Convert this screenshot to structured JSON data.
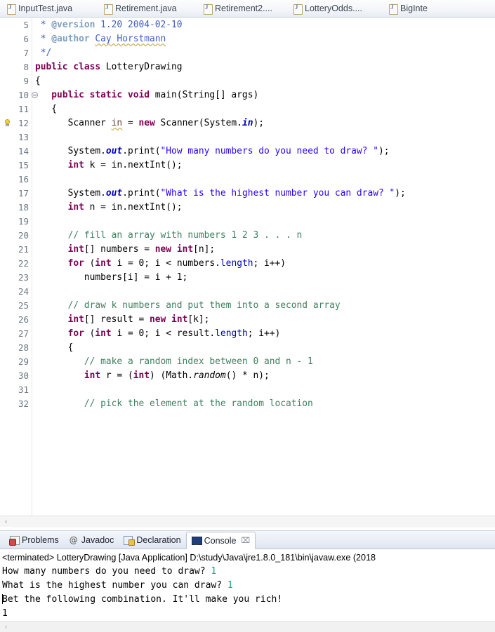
{
  "editor_tabs": [
    {
      "label": "InputTest.java",
      "icon": "java-file-icon",
      "active": false
    },
    {
      "label": "Retirement.java",
      "icon": "java-file-icon",
      "active": false
    },
    {
      "label": "Retirement2....",
      "icon": "java-file-icon",
      "active": false
    },
    {
      "label": "LotteryOdds....",
      "icon": "java-file-icon",
      "active": false
    },
    {
      "label": "BigInte",
      "icon": "java-file-icon",
      "active": false
    }
  ],
  "code": {
    "first_line_number": 5,
    "lines": [
      {
        "n": "5",
        "marker": "",
        "fold": false,
        "tokens": [
          {
            "t": " * ",
            "c": "jdoc"
          },
          {
            "t": "@version",
            "c": "jtag"
          },
          {
            "t": " 1.20 2004-02-10",
            "c": "jdoc"
          }
        ]
      },
      {
        "n": "6",
        "marker": "",
        "fold": false,
        "tokens": [
          {
            "t": " * ",
            "c": "jdoc"
          },
          {
            "t": "@author",
            "c": "jtag"
          },
          {
            "t": " ",
            "c": "jdoc"
          },
          {
            "t": "Cay Horstmann",
            "c": "jdoc ul-sq"
          }
        ]
      },
      {
        "n": "7",
        "marker": "",
        "fold": false,
        "tokens": [
          {
            "t": " */",
            "c": "jdoc"
          }
        ]
      },
      {
        "n": "8",
        "marker": "",
        "fold": false,
        "tokens": [
          {
            "t": "public class",
            "c": "kw"
          },
          {
            "t": " LotteryDrawing",
            "c": "plain"
          }
        ]
      },
      {
        "n": "9",
        "marker": "",
        "fold": false,
        "tokens": [
          {
            "t": "{",
            "c": "plain"
          }
        ]
      },
      {
        "n": "10",
        "marker": "",
        "fold": true,
        "tokens": [
          {
            "t": "   ",
            "c": "plain"
          },
          {
            "t": "public static void",
            "c": "kw"
          },
          {
            "t": " main(String[] args)",
            "c": "plain"
          }
        ]
      },
      {
        "n": "11",
        "marker": "",
        "fold": false,
        "tokens": [
          {
            "t": "   {",
            "c": "plain"
          }
        ]
      },
      {
        "n": "12",
        "marker": "warning",
        "fold": false,
        "tokens": [
          {
            "t": "      Scanner ",
            "c": "plain"
          },
          {
            "t": "in",
            "c": "loc ul-sq"
          },
          {
            "t": " = ",
            "c": "plain"
          },
          {
            "t": "new",
            "c": "kw"
          },
          {
            "t": " Scanner(System.",
            "c": "plain"
          },
          {
            "t": "in",
            "c": "sfld"
          },
          {
            "t": ");",
            "c": "plain"
          }
        ]
      },
      {
        "n": "13",
        "marker": "",
        "fold": false,
        "tokens": [
          {
            "t": "",
            "c": "plain"
          }
        ]
      },
      {
        "n": "14",
        "marker": "",
        "fold": false,
        "tokens": [
          {
            "t": "      System.",
            "c": "plain"
          },
          {
            "t": "out",
            "c": "sfld"
          },
          {
            "t": ".print(",
            "c": "plain"
          },
          {
            "t": "\"How many numbers do you need to draw? \"",
            "c": "str"
          },
          {
            "t": ");",
            "c": "plain"
          }
        ]
      },
      {
        "n": "15",
        "marker": "",
        "fold": false,
        "tokens": [
          {
            "t": "      ",
            "c": "plain"
          },
          {
            "t": "int",
            "c": "kw"
          },
          {
            "t": " k = in.nextInt();",
            "c": "plain"
          }
        ]
      },
      {
        "n": "16",
        "marker": "",
        "fold": false,
        "tokens": [
          {
            "t": "",
            "c": "plain"
          }
        ]
      },
      {
        "n": "17",
        "marker": "",
        "fold": false,
        "tokens": [
          {
            "t": "      System.",
            "c": "plain"
          },
          {
            "t": "out",
            "c": "sfld"
          },
          {
            "t": ".print(",
            "c": "plain"
          },
          {
            "t": "\"What is the highest number you can draw? \"",
            "c": "str"
          },
          {
            "t": ");",
            "c": "plain"
          }
        ]
      },
      {
        "n": "18",
        "marker": "",
        "fold": false,
        "tokens": [
          {
            "t": "      ",
            "c": "plain"
          },
          {
            "t": "int",
            "c": "kw"
          },
          {
            "t": " n = in.nextInt();",
            "c": "plain"
          }
        ]
      },
      {
        "n": "19",
        "marker": "",
        "fold": false,
        "tokens": [
          {
            "t": "",
            "c": "plain"
          }
        ]
      },
      {
        "n": "20",
        "marker": "",
        "fold": false,
        "tokens": [
          {
            "t": "      ",
            "c": "plain"
          },
          {
            "t": "// fill an array with numbers 1 2 3 . . . n",
            "c": "cmt"
          }
        ]
      },
      {
        "n": "21",
        "marker": "",
        "fold": false,
        "tokens": [
          {
            "t": "      ",
            "c": "plain"
          },
          {
            "t": "int",
            "c": "kw"
          },
          {
            "t": "[] numbers = ",
            "c": "plain"
          },
          {
            "t": "new int",
            "c": "kw"
          },
          {
            "t": "[n];",
            "c": "plain"
          }
        ]
      },
      {
        "n": "22",
        "marker": "",
        "fold": false,
        "tokens": [
          {
            "t": "      ",
            "c": "plain"
          },
          {
            "t": "for",
            "c": "kw"
          },
          {
            "t": " (",
            "c": "plain"
          },
          {
            "t": "int",
            "c": "kw"
          },
          {
            "t": " i = 0; i < numbers.",
            "c": "plain"
          },
          {
            "t": "length",
            "c": "fld"
          },
          {
            "t": "; i++)",
            "c": "plain"
          }
        ]
      },
      {
        "n": "23",
        "marker": "",
        "fold": false,
        "tokens": [
          {
            "t": "         numbers[i] = i + 1;",
            "c": "plain"
          }
        ]
      },
      {
        "n": "24",
        "marker": "",
        "fold": false,
        "tokens": [
          {
            "t": "",
            "c": "plain"
          }
        ]
      },
      {
        "n": "25",
        "marker": "",
        "fold": false,
        "tokens": [
          {
            "t": "      ",
            "c": "plain"
          },
          {
            "t": "// draw k numbers and put them into a second array",
            "c": "cmt"
          }
        ]
      },
      {
        "n": "26",
        "marker": "",
        "fold": false,
        "tokens": [
          {
            "t": "      ",
            "c": "plain"
          },
          {
            "t": "int",
            "c": "kw"
          },
          {
            "t": "[] result = ",
            "c": "plain"
          },
          {
            "t": "new int",
            "c": "kw"
          },
          {
            "t": "[k];",
            "c": "plain"
          }
        ]
      },
      {
        "n": "27",
        "marker": "",
        "fold": false,
        "tokens": [
          {
            "t": "      ",
            "c": "plain"
          },
          {
            "t": "for",
            "c": "kw"
          },
          {
            "t": " (",
            "c": "plain"
          },
          {
            "t": "int",
            "c": "kw"
          },
          {
            "t": " i = 0; i < result.",
            "c": "plain"
          },
          {
            "t": "length",
            "c": "fld"
          },
          {
            "t": "; i++)",
            "c": "plain"
          }
        ]
      },
      {
        "n": "28",
        "marker": "",
        "fold": false,
        "tokens": [
          {
            "t": "      {",
            "c": "plain"
          }
        ]
      },
      {
        "n": "29",
        "marker": "",
        "fold": false,
        "tokens": [
          {
            "t": "         ",
            "c": "plain"
          },
          {
            "t": "// make a random index between 0 and n - 1",
            "c": "cmt"
          }
        ]
      },
      {
        "n": "30",
        "marker": "",
        "fold": false,
        "tokens": [
          {
            "t": "         ",
            "c": "plain"
          },
          {
            "t": "int",
            "c": "kw"
          },
          {
            "t": " r = (",
            "c": "plain"
          },
          {
            "t": "int",
            "c": "kw"
          },
          {
            "t": ") (Math.",
            "c": "plain"
          },
          {
            "t": "random",
            "c": "smeth"
          },
          {
            "t": "() * n);",
            "c": "plain"
          }
        ]
      },
      {
        "n": "31",
        "marker": "",
        "fold": false,
        "tokens": [
          {
            "t": "",
            "c": "plain"
          }
        ]
      },
      {
        "n": "32",
        "marker": "",
        "fold": false,
        "tokens": [
          {
            "t": "         ",
            "c": "plain"
          },
          {
            "t": "// pick the element at the random location",
            "c": "cmt"
          }
        ]
      }
    ]
  },
  "view_tabs": [
    {
      "label": "Problems",
      "icon": "problems-icon",
      "active": false,
      "closable": false
    },
    {
      "label": "Javadoc",
      "icon": "javadoc-icon",
      "active": false,
      "closable": false
    },
    {
      "label": "Declaration",
      "icon": "declaration-icon",
      "active": false,
      "closable": false
    },
    {
      "label": "Console",
      "icon": "console-icon",
      "active": true,
      "closable": true,
      "close_glyph": "⌧"
    }
  ],
  "console": {
    "process_header": "<terminated> LotteryDrawing [Java Application] D:\\study\\Java\\jre1.8.0_181\\bin\\javaw.exe (2018",
    "lines": [
      {
        "prompt": "How many numbers do you need to draw? ",
        "input": "1",
        "caret": false
      },
      {
        "prompt": "What is the highest number you can draw? ",
        "input": "1",
        "caret": false
      },
      {
        "prompt": "Bet the following combination. It'll make you rich!",
        "input": "",
        "caret": true
      },
      {
        "prompt": "1",
        "input": "",
        "caret": false
      }
    ]
  },
  "scrollbars": {
    "editor_left_arrow": "‹",
    "bottom_left_arrow": "‹"
  },
  "colors": {
    "keyword": "#7f0055",
    "string": "#2a00ff",
    "comment": "#3f7f5f",
    "javadoc": "#3f5fbf",
    "field": "#0000c0",
    "console_input": "#1aa37a",
    "tab_active_bg": "#ffffff"
  }
}
